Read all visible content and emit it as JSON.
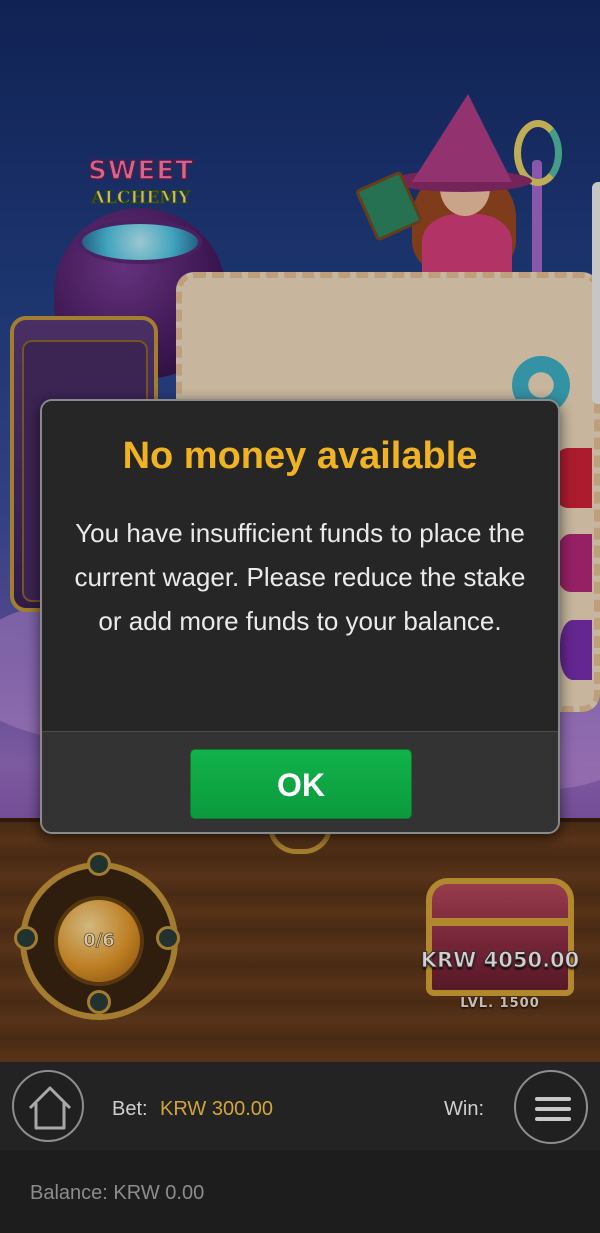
{
  "game": {
    "logo_line1": "SWEET",
    "logo_line2": "ALCHEMY",
    "collect_meter": "0/6",
    "jackpot": {
      "amount": "KRW 4050.00",
      "level": "LVL. 1500"
    }
  },
  "dialog": {
    "title": "No money available",
    "message": "You have insufficient funds to place the current wager. Please reduce the stake or add more funds to your balance.",
    "ok_label": "OK"
  },
  "bottom_bar": {
    "bet_label": "Bet:",
    "bet_value": "KRW 300.00",
    "win_label": "Win:",
    "balance_label": "Balance:",
    "balance_value": "KRW 0.00"
  },
  "icons": {
    "home": "home-icon",
    "menu": "hamburger-menu-icon"
  },
  "colors": {
    "title_accent": "#f0b323",
    "ok_button": "#0ea843",
    "bet_value": "#d2a53a"
  }
}
